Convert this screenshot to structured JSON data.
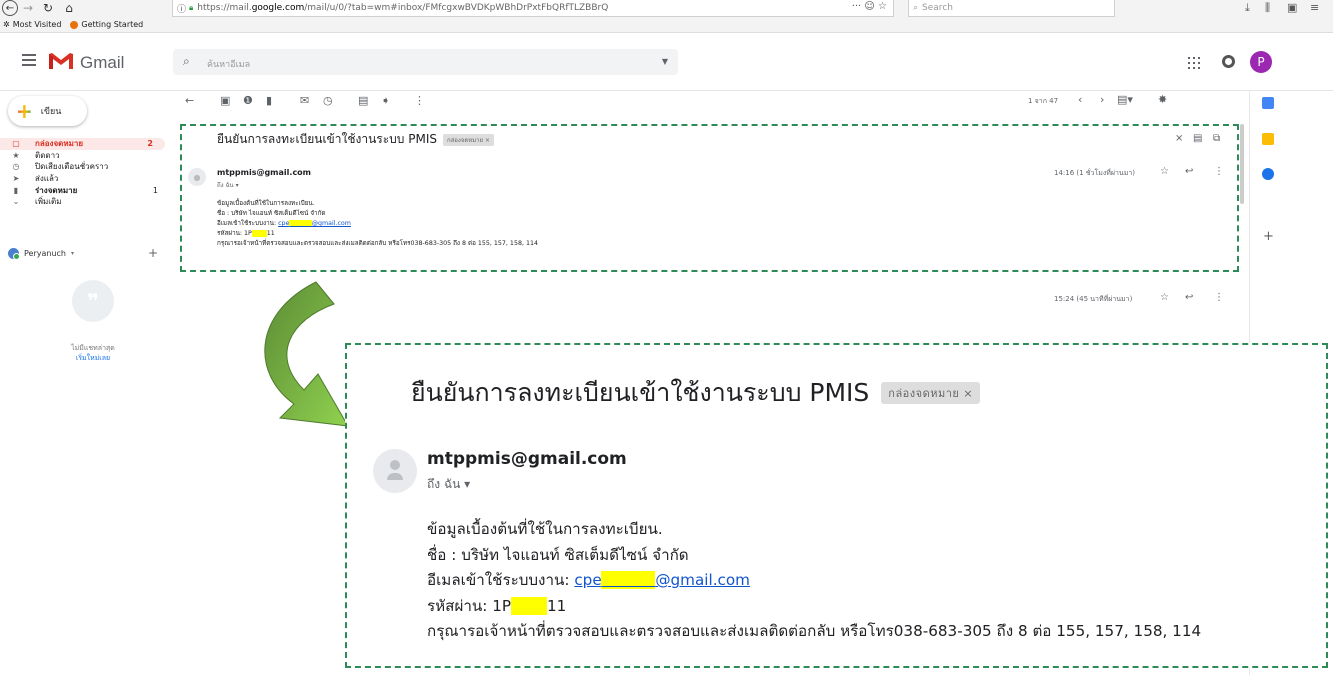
{
  "browser": {
    "url_prefix": "https://mail.",
    "url_domain": "google.com",
    "url_rest": "/mail/u/0/?tab=wm#inbox/FMfcgxwBVDKpWBhDrPxtFbQRfTLZBBrQ",
    "url_actions": "··· ☺ ☆",
    "search_placeholder": "Search",
    "bookmarks": [
      "Most Visited",
      "Getting Started"
    ]
  },
  "gmail": {
    "app_name": "Gmail",
    "search_placeholder": "ค้นหาอีเมล",
    "avatar_letter": "P",
    "accent_color": "#d93025"
  },
  "sidebar": {
    "compose_label": "เขียน",
    "items": [
      {
        "label": "กล่องจดหมาย",
        "count": "2",
        "icon": "inbox-icon"
      },
      {
        "label": "ติดดาว",
        "count": "",
        "icon": "star-icon"
      },
      {
        "label": "ปิดเสียงเตือนชั่วคราว",
        "count": "",
        "icon": "clock-icon"
      },
      {
        "label": "ส่งแล้ว",
        "count": "",
        "icon": "send-icon"
      },
      {
        "label": "ร่างจดหมาย",
        "count": "1",
        "icon": "draft-icon"
      },
      {
        "label": "เพิ่มเติม",
        "count": "",
        "icon": "chevron-down-icon"
      }
    ],
    "account_name": "Peryanuch",
    "no_recent_chats": "ไม่มีแชทล่าสุด",
    "start_new": "เริ่มใหม่เลย"
  },
  "toolbar": {
    "pager_text": "1 จาก 47"
  },
  "email": {
    "subject": "ยืนยันการลงทะเบียนเข้าใช้งานระบบ PMIS",
    "label": "กล่องจดหมาย ×",
    "sender": "mtppmis@gmail.com",
    "to": "ถึง ฉัน ▾",
    "time_small": "14:16 (1 ชั่วโมงที่ผ่านมา)",
    "second_time": "15:24 (45 นาทีที่ผ่านมา)",
    "body_line1": "ข้อมูลเบื้องต้นที่ใช้ในการลงทะเบียน.",
    "body_line2": "ชื่อ : บริษัท ไจแอนท์ ซิสเต็มดีไซน์ จำกัด",
    "body_line3_prefix": "อีเมลเข้าใช้ระบบงาน: ",
    "email_part1": "cpe",
    "email_hidden": "xxxxxx",
    "email_part2": "@gmail.com",
    "body_line4_prefix": "รหัสผ่าน: 1P",
    "password_hidden": "xxxx",
    "password_suffix": "11",
    "body_line5": "กรุณารอเจ้าหน้าที่ตรวจสอบและตรวจสอบและส่งเมลติดต่อกลับ หรือโทร038-683-305 ถึง 8 ต่อ 155, 157, 158, 114"
  },
  "colors": {
    "highlight": "#ffff00",
    "dashed_border": "#2e8b57",
    "arrow_fill": "#7ac143"
  }
}
